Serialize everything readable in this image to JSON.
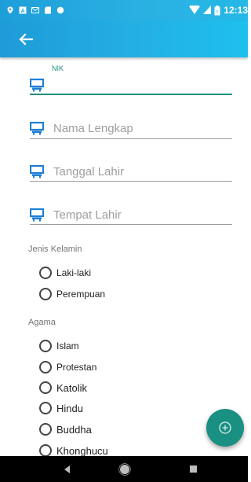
{
  "status_bar": {
    "time": "12:13",
    "left_icons": [
      "location-icon",
      "notification-a-icon",
      "gmail-icon",
      "sd-card-icon",
      "record-icon"
    ],
    "right_icons": [
      "wifi-icon",
      "signal-icon",
      "battery-icon"
    ]
  },
  "app_bar": {
    "back_icon": "arrow-back-icon",
    "color_start": "#1e9bd8",
    "color_end": "#1dc0ee"
  },
  "form": {
    "nik": {
      "label": "NIK",
      "value": "",
      "icon": "id-card-icon"
    },
    "nama_lengkap": {
      "placeholder": "Nama Lengkap",
      "icon": "id-card-icon"
    },
    "tanggal_lahir": {
      "placeholder": "Tanggal Lahir",
      "icon": "id-card-icon"
    },
    "tempat_lahir": {
      "placeholder": "Tempat Lahir",
      "icon": "id-card-icon"
    },
    "jenis_kelamin": {
      "label": "Jenis Kelamin",
      "options": [
        "Laki-laki",
        "Perempuan"
      ]
    },
    "agama": {
      "label": "Agama",
      "options": [
        "Islam",
        "Protestan",
        "Katolik",
        "Hindu",
        "Buddha",
        "Khonghucu"
      ]
    }
  },
  "fab": {
    "icon": "add-circle-icon",
    "color": "#1a9082"
  },
  "nav_bar": {
    "buttons": [
      "back-triangle-icon",
      "home-circle-icon",
      "recents-square-icon"
    ]
  },
  "colors": {
    "accent": "#1e8f80",
    "icon_blue": "#1f7fd6"
  }
}
